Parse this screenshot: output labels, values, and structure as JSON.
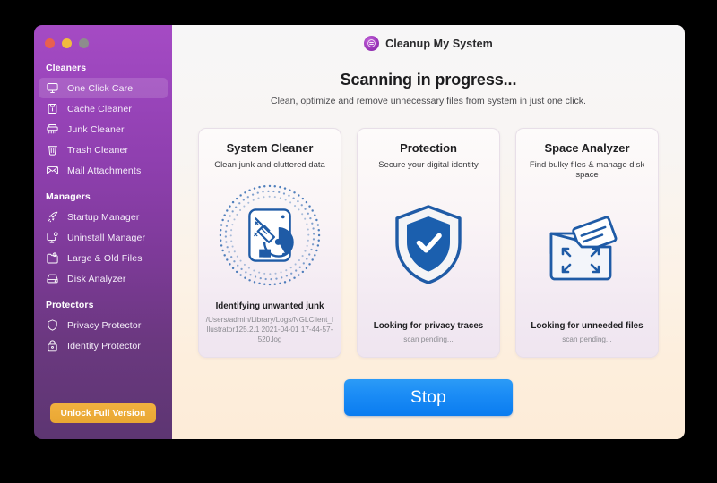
{
  "window": {
    "traffic_lights": [
      {
        "name": "close",
        "color": "#e8604f"
      },
      {
        "name": "minimize",
        "color": "#f0bc3f"
      },
      {
        "name": "maximize",
        "color": "#8d8d8d"
      }
    ]
  },
  "sidebar": {
    "groups": [
      {
        "title": "Cleaners",
        "items": [
          {
            "label": "One Click Care",
            "icon": "monitor-icon",
            "active": true
          },
          {
            "label": "Cache Cleaner",
            "icon": "cache-box-icon",
            "active": false
          },
          {
            "label": "Junk Cleaner",
            "icon": "shredder-icon",
            "active": false
          },
          {
            "label": "Trash Cleaner",
            "icon": "trash-icon",
            "active": false
          },
          {
            "label": "Mail Attachments",
            "icon": "envelope-icon",
            "active": false
          }
        ]
      },
      {
        "title": "Managers",
        "items": [
          {
            "label": "Startup Manager",
            "icon": "rocket-icon",
            "active": false
          },
          {
            "label": "Uninstall Manager",
            "icon": "monitor-gear-icon",
            "active": false
          },
          {
            "label": "Large & Old Files",
            "icon": "folder-clock-icon",
            "active": false
          },
          {
            "label": "Disk Analyzer",
            "icon": "disk-drive-icon",
            "active": false
          }
        ]
      },
      {
        "title": "Protectors",
        "items": [
          {
            "label": "Privacy Protector",
            "icon": "shield-icon",
            "active": false
          },
          {
            "label": "Identity Protector",
            "icon": "lock-icon",
            "active": false
          }
        ]
      }
    ],
    "unlock_label": "Unlock Full Version",
    "unlock_color": "#eaa733"
  },
  "header": {
    "app_name": "Cleanup My System",
    "app_logo_icon": "app-logo-icon",
    "headline": "Scanning in progress...",
    "subhead": "Clean, optimize and remove unnecessary files from system in just one click."
  },
  "cards": [
    {
      "title": "System Cleaner",
      "subtitle": "Clean junk and cluttered data",
      "icon": "broom-sweep-icon",
      "status": "Identifying unwanted junk",
      "detail": "/Users/admin/Library/Logs/NGLClient_Illustrator125.2.1 2021-04-01 17-44-57-520.log"
    },
    {
      "title": "Protection",
      "subtitle": "Secure your digital identity",
      "icon": "shield-check-icon",
      "status": "Looking for privacy traces",
      "detail": "scan pending..."
    },
    {
      "title": "Space Analyzer",
      "subtitle": "Find bulky files & manage disk space",
      "icon": "folder-expand-icon",
      "status": "Looking for unneeded files",
      "detail": "scan pending..."
    }
  ],
  "footer": {
    "stop_label": "Stop",
    "stop_color": "#0a7cf0"
  }
}
